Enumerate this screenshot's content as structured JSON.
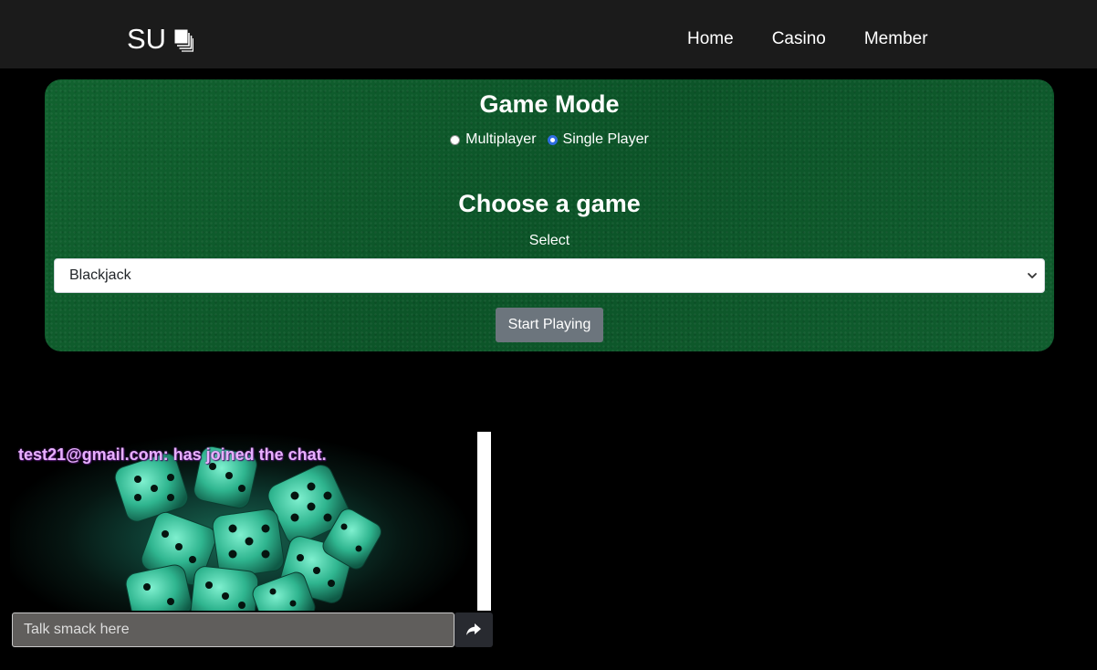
{
  "nav": {
    "brand": "SU",
    "links": [
      "Home",
      "Casino",
      "Member"
    ]
  },
  "game_panel": {
    "mode_title": "Game Mode",
    "modes": [
      {
        "label": "Multiplayer",
        "checked": false
      },
      {
        "label": "Single Player",
        "checked": true
      }
    ],
    "choose_title": "Choose a game",
    "select_label": "Select",
    "selected_game": "Blackjack",
    "start_button": "Start Playing"
  },
  "chat": {
    "messages": [
      "test21@gmail.com: has joined the chat."
    ],
    "input_placeholder": "Talk smack here"
  },
  "colors": {
    "felt_green": "#0e5a2c",
    "navbar": "#1b1b1b",
    "radio_accent": "#2f6de1",
    "start_button": "#6c757d",
    "chat_text": "#e8b0ff"
  }
}
